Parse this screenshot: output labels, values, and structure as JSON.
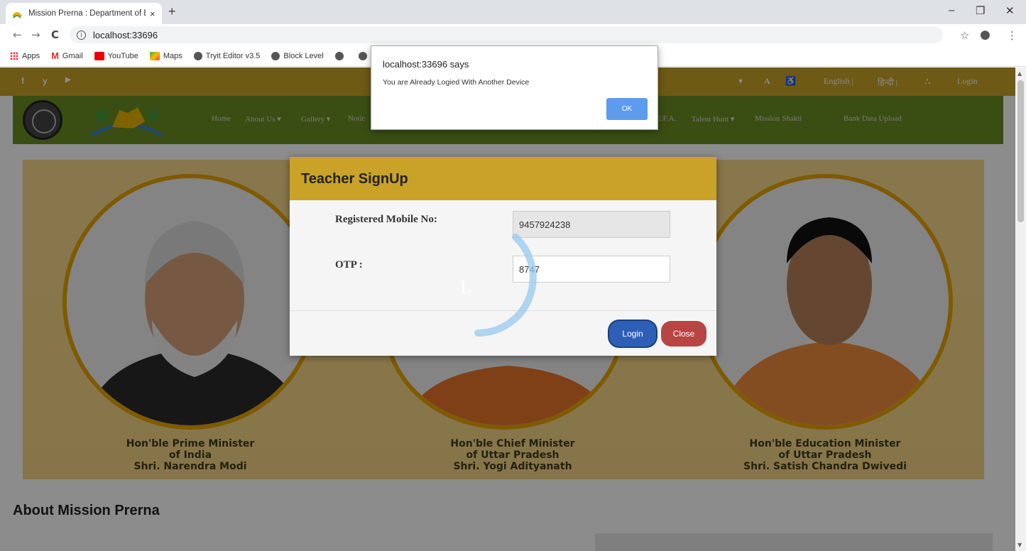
{
  "browser": {
    "tab_title": "Mission Prerna : Department of Basic Education",
    "tab_close": "×",
    "new_tab": "+",
    "window_controls": {
      "minimize": "–",
      "restore": "❐",
      "close": "✕"
    },
    "nav": {
      "back": "←",
      "forward": "→",
      "reload": "C"
    },
    "url": "localhost:33696",
    "bookmarks": [
      "Apps",
      "Gmail",
      "YouTube",
      "Maps",
      "Tryit Editor v3.5",
      "Block Level"
    ]
  },
  "site": {
    "topbar": {
      "social": [
        "f",
        "y",
        "▶"
      ],
      "font_size": "A",
      "lang_english": "English |",
      "lang_hindi": "हिन्दी |",
      "login": "Login"
    },
    "nav_items": [
      "Home",
      "About Us ▾",
      "Gallery ▾",
      "Notic",
      "E.F.A.",
      "Talent Hunt ▾",
      "Mission Shakti",
      "Bank Data Upload"
    ],
    "banner": {
      "captions": [
        {
          "line1": "Hon'ble Prime Minister",
          "line2": "of India",
          "line3": "Shri. Narendra Modi"
        },
        {
          "line1": "Hon'ble Chief Minister",
          "line2": "of Uttar Pradesh",
          "line3": "Shri. Yogi Adityanath"
        },
        {
          "line1": "Hon'ble Education Minister",
          "line2": "of Uttar Pradesh",
          "line3": "Shri. Satish Chandra Dwivedi"
        }
      ]
    },
    "about_title": "About Mission Prerna"
  },
  "modal": {
    "title": "Teacher SignUp",
    "mobile_label": "Registered Mobile No:",
    "mobile_value": "9457924238",
    "otp_label": "OTP :",
    "otp_value": "8747",
    "login_button": "Login",
    "close_button": "Close",
    "spinner_letter": "L"
  },
  "alert": {
    "title": "localhost:33696 says",
    "message": "You are Already Logied With Another Device",
    "ok_button": "OK"
  },
  "colors": {
    "gold": "#c9a227",
    "olive": "#6b8e23",
    "login_blue": "#2d5fb6",
    "close_red": "#b84444",
    "alert_ok": "#5d9cec"
  }
}
